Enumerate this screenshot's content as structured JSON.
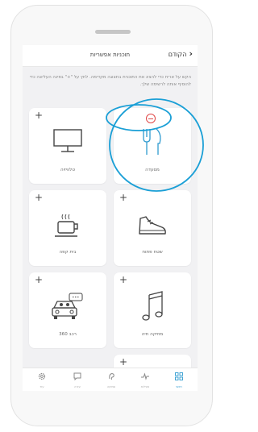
{
  "header": {
    "back_label": "הקודם",
    "title": "תוכניות אפשריות"
  },
  "instructions": "הקש על אריח כדי להציג את התוכנית בתצוגה מקדימה. לחץ על \"+\" בפינה העליונה כדי להוסיף אותה לרשימה שלך.",
  "programs": [
    {
      "id": "tv",
      "label": "טלוויזיה",
      "icon": "tv-icon",
      "action": "+"
    },
    {
      "id": "restaurant",
      "label": "מסעדה",
      "icon": "fork-knife-icon",
      "action": "−"
    },
    {
      "id": "cafe",
      "label": "בית קפה",
      "icon": "coffee-cup-icon",
      "action": "+"
    },
    {
      "id": "outdoor",
      "label": "שטח פתוח",
      "icon": "sneaker-icon",
      "action": "+"
    },
    {
      "id": "car",
      "label": "360 רכב",
      "icon": "car-icon",
      "action": "+"
    },
    {
      "id": "music",
      "label": "מוזיקה חיה",
      "icon": "music-note-icon",
      "action": "+"
    },
    {
      "id": "crowd",
      "label": "",
      "icon": "crowd-icon",
      "action": "+"
    }
  ],
  "tabbar": [
    {
      "id": "settings",
      "label": "עוד",
      "icon": "gear-icon"
    },
    {
      "id": "help",
      "label": "עזרה",
      "icon": "chat-bubble-icon"
    },
    {
      "id": "hearing",
      "label": "שמיעה",
      "icon": "ear-icon"
    },
    {
      "id": "activity",
      "label": "פעילות",
      "icon": "pulse-icon"
    },
    {
      "id": "home",
      "label": "ראשי",
      "icon": "grid-icon"
    }
  ],
  "colors": {
    "accent": "#2f9bd0",
    "remove": "#e04848",
    "annotation": "#1a9fd6"
  }
}
